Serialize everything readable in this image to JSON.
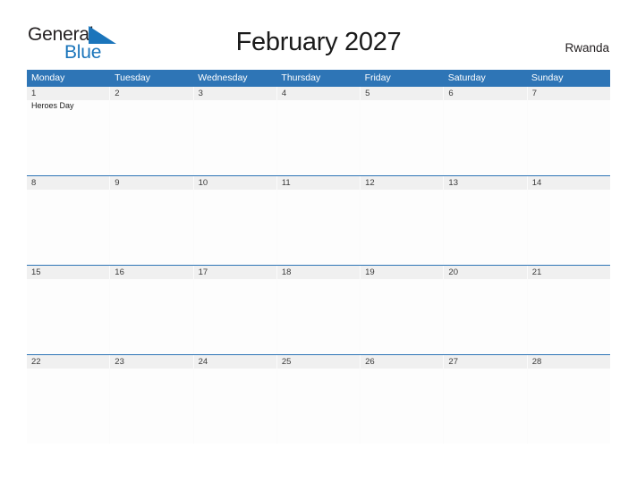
{
  "brand": {
    "name_part1": "General",
    "name_part2": "Blue",
    "triangle_icon": "blue-triangle-logo-mark",
    "color_dark": "#231f20",
    "color_blue": "#1b75bb"
  },
  "header": {
    "title": "February 2027",
    "country": "Rwanda",
    "accent_color": "#2e75b6"
  },
  "calendar": {
    "weekdays": [
      "Monday",
      "Tuesday",
      "Wednesday",
      "Thursday",
      "Friday",
      "Saturday",
      "Sunday"
    ],
    "weeks": [
      {
        "days": [
          {
            "num": "1",
            "events": [
              "Heroes Day"
            ]
          },
          {
            "num": "2",
            "events": []
          },
          {
            "num": "3",
            "events": []
          },
          {
            "num": "4",
            "events": []
          },
          {
            "num": "5",
            "events": []
          },
          {
            "num": "6",
            "events": []
          },
          {
            "num": "7",
            "events": []
          }
        ]
      },
      {
        "days": [
          {
            "num": "8",
            "events": []
          },
          {
            "num": "9",
            "events": []
          },
          {
            "num": "10",
            "events": []
          },
          {
            "num": "11",
            "events": []
          },
          {
            "num": "12",
            "events": []
          },
          {
            "num": "13",
            "events": []
          },
          {
            "num": "14",
            "events": []
          }
        ]
      },
      {
        "days": [
          {
            "num": "15",
            "events": []
          },
          {
            "num": "16",
            "events": []
          },
          {
            "num": "17",
            "events": []
          },
          {
            "num": "18",
            "events": []
          },
          {
            "num": "19",
            "events": []
          },
          {
            "num": "20",
            "events": []
          },
          {
            "num": "21",
            "events": []
          }
        ]
      },
      {
        "days": [
          {
            "num": "22",
            "events": []
          },
          {
            "num": "23",
            "events": []
          },
          {
            "num": "24",
            "events": []
          },
          {
            "num": "25",
            "events": []
          },
          {
            "num": "26",
            "events": []
          },
          {
            "num": "27",
            "events": []
          },
          {
            "num": "28",
            "events": []
          }
        ]
      }
    ]
  }
}
